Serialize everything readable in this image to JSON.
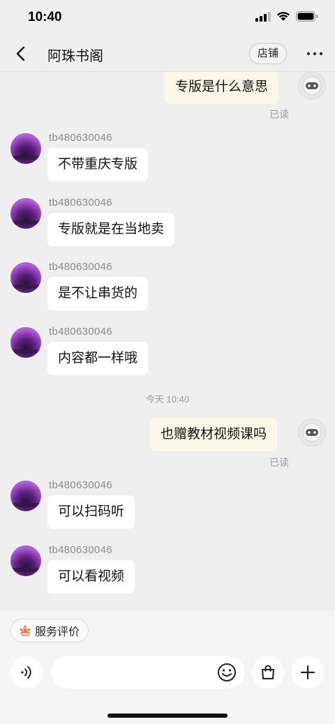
{
  "status": {
    "time": "10:40"
  },
  "header": {
    "title": "阿珠书阁",
    "shop_label": "店铺"
  },
  "messages": [
    {
      "dir": "out",
      "text": "专版是什么意思",
      "read": "已读"
    },
    {
      "dir": "in",
      "sender": "tb480630046",
      "text": "不带重庆专版"
    },
    {
      "dir": "in",
      "sender": "tb480630046",
      "text": "专版就是在当地卖"
    },
    {
      "dir": "in",
      "sender": "tb480630046",
      "text": "是不让串货的"
    },
    {
      "dir": "in",
      "sender": "tb480630046",
      "text": "内容都一样哦"
    },
    {
      "dir": "time",
      "text": "今天 10:40"
    },
    {
      "dir": "out",
      "text": "也赠教材视频课吗",
      "read": "已读"
    },
    {
      "dir": "in",
      "sender": "tb480630046",
      "text": "可以扫码听"
    },
    {
      "dir": "in",
      "sender": "tb480630046",
      "text": "可以看视频"
    }
  ],
  "footer": {
    "service_label": "服务评价",
    "input_value": "",
    "icons": [
      "voice-icon",
      "emoji-icon",
      "shopping-bag-icon",
      "plus-icon"
    ]
  },
  "colors": {
    "bubble_in": "#ffffff",
    "bubble_out": "#fdf7e7",
    "background": "#efefef",
    "service_icon": "#e8733a"
  }
}
